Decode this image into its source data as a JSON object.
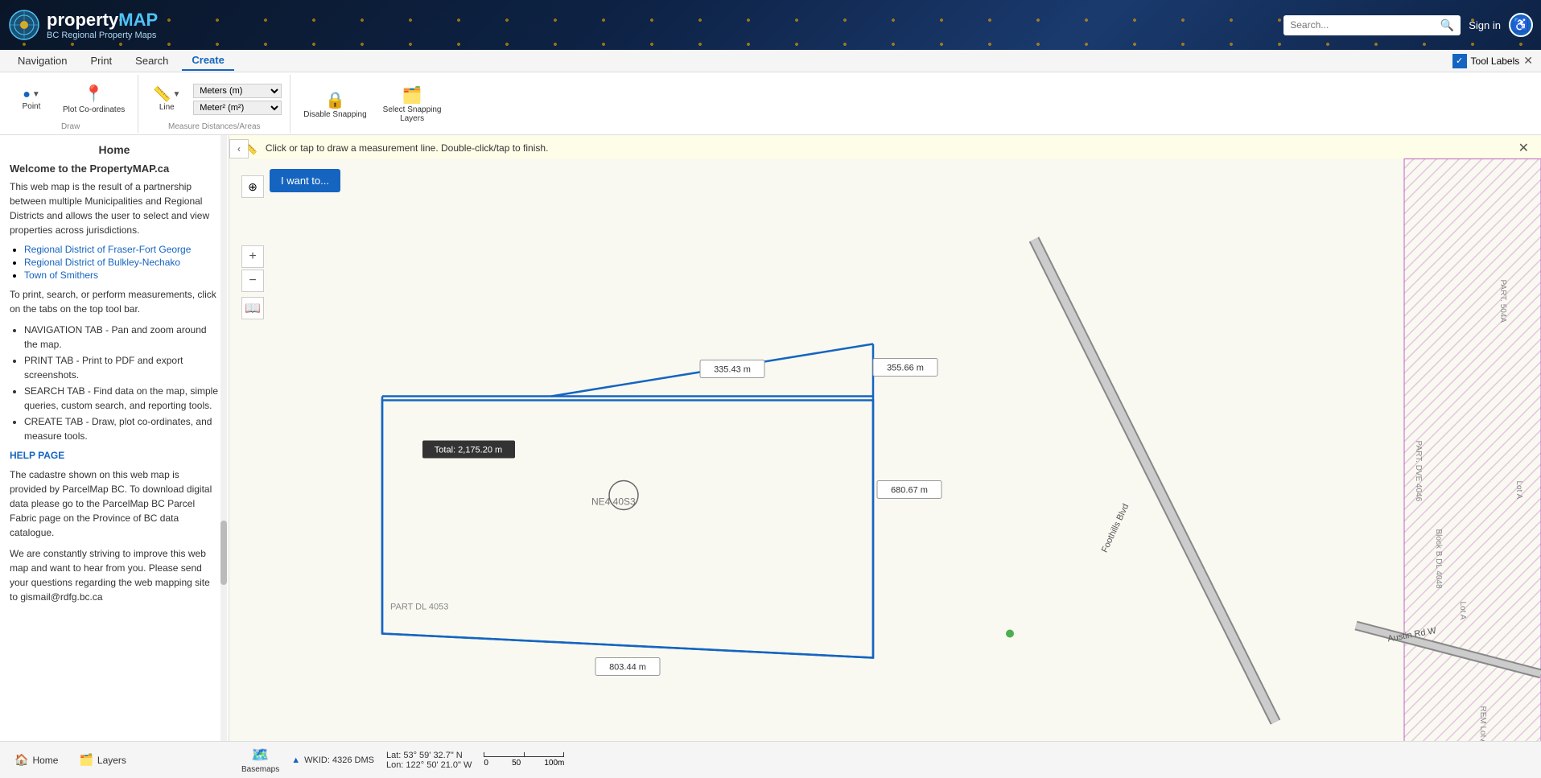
{
  "header": {
    "logo_property": "property",
    "logo_map": "MAP",
    "logo_subtitle": "BC Regional Property Maps",
    "search_placeholder": "Search...",
    "sign_in": "Sign in"
  },
  "topnav": {
    "items": [
      "Navigation",
      "Print",
      "Search",
      "Create"
    ],
    "active": "Create",
    "tool_labels": "Tool Labels"
  },
  "toolbar": {
    "draw_section_label": "Draw",
    "plot_coords_label": "Plot Co-ordinates",
    "measure_section_label": "Measure Distances/Areas",
    "line_label": "Line",
    "point_label": "Point",
    "meters_option": "Meters (m)",
    "meters_sq_option": "Meter² (m²)",
    "disable_snapping_label": "Disable Snapping",
    "select_snapping_layers_label": "Select Snapping\nLayers"
  },
  "sidebar": {
    "home_title": "Home",
    "welcome_heading": "Welcome to the PropertyMAP.ca",
    "intro_text": "This web map is the result of a partnership between multiple Municipalities and Regional Districts and allows the user to select and view properties across jurisdictions.",
    "links": [
      "Regional District of Fraser-Fort George",
      "Regional District of Bulkley-Nechako",
      "Town of Smithers"
    ],
    "instructions_text": "To print, search, or perform measurements, click on the tabs on the top tool bar.",
    "nav_tab_desc": "NAVIGATION TAB - Pan and zoom around the map.",
    "print_tab_desc": "PRINT TAB - Print to PDF and export screenshots.",
    "search_tab_desc": "SEARCH TAB - Find data on the map, simple queries, custom search, and reporting tools.",
    "create_tab_desc": "CREATE TAB - Draw, plot co-ordinates, and measure tools.",
    "help_link": "HELP PAGE",
    "cadastre_text": "The cadastre shown on this web map is provided by ParcelMap BC. To download digital data please go to the ParcelMap BC Parcel Fabric page on the Province of BC data catalogue.",
    "improve_text": "We are constantly striving to improve this web map and want to hear from you. Please send your questions regarding the web mapping site to gismail@rdfg.bc.ca"
  },
  "notification": {
    "message": "Click or tap to draw a measurement line. Double-click/tap to finish."
  },
  "measurement_labels": {
    "total": "Total: 2,175.20 m",
    "seg1": "335.43 m",
    "seg2": "355.66 m",
    "seg3": "680.67 m",
    "seg4": "803.44 m"
  },
  "map_parcels": {
    "ne4_label": "NE4   40S3",
    "part_dl_label": "PART DL 4053"
  },
  "bottom_bar": {
    "basemaps_label": "Basemaps",
    "wkid": "WKID: 4326 DMS",
    "lat": "Lat: 53° 59' 32.7\" N",
    "lon": "Lon: 122° 50' 21.0\" W",
    "scale_0": "0",
    "scale_50": "50",
    "scale_100": "100m"
  },
  "footer": {
    "home_label": "Home",
    "layers_label": "Layers"
  },
  "roads": {
    "foothills_blvd": "Foothills Blvd",
    "austin_rd": "Austin Rd W"
  }
}
